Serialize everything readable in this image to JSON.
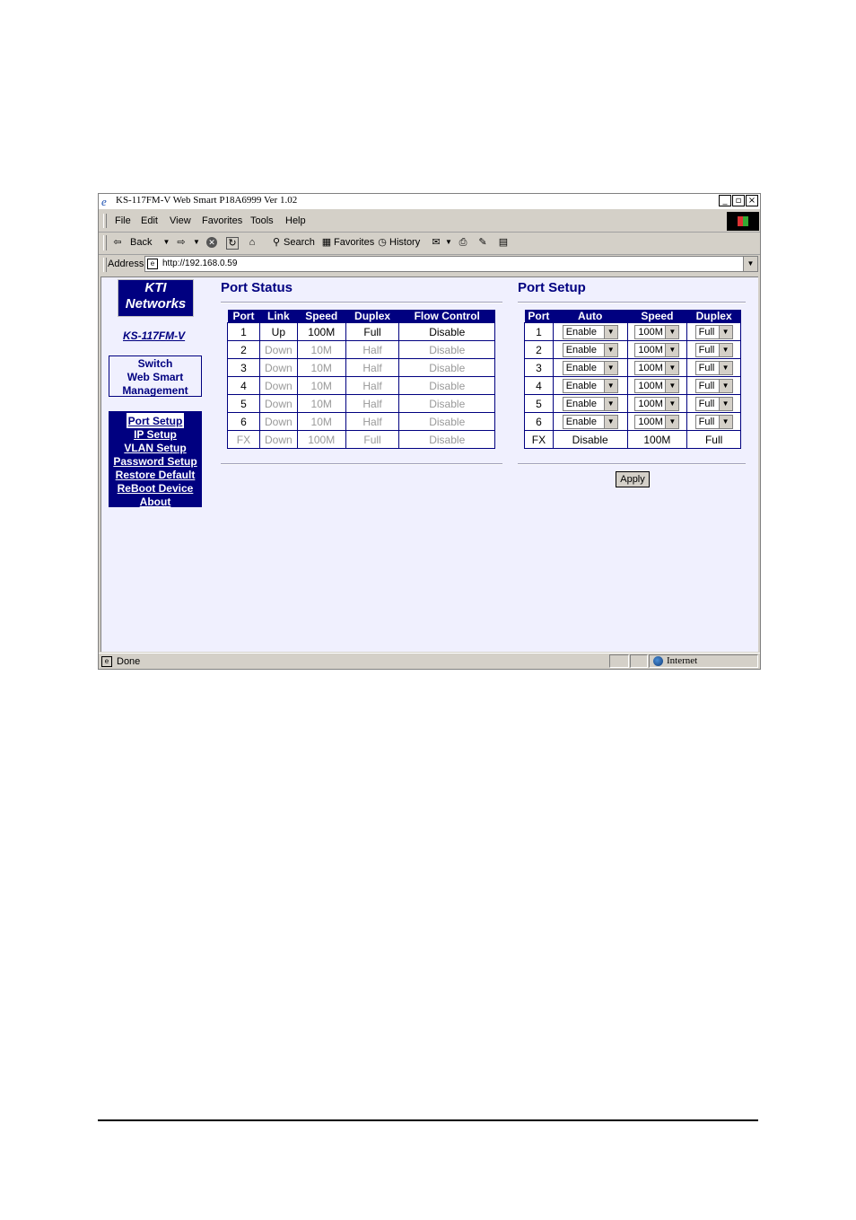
{
  "window": {
    "title": "KS-117FM-V Web Smart P18A6999 Ver 1.02",
    "buttons": [
      "_",
      "▫",
      "×"
    ]
  },
  "menu": [
    "File",
    "Edit",
    "View",
    "Favorites",
    "Tools",
    "Help"
  ],
  "toolbar": {
    "back": "Back",
    "search": "Search",
    "favorites": "Favorites",
    "history": "History"
  },
  "address": {
    "label": "Address",
    "url": "http://192.168.0.59"
  },
  "sidebar": {
    "logo_line1": "KTI",
    "logo_line2": "Networks",
    "model": "KS-117FM-V",
    "box_line1": "Switch",
    "box_line2": "Web Smart",
    "box_line3": "Management",
    "nav": [
      "Port Setup",
      "IP Setup",
      "VLAN Setup",
      "Password Setup",
      "Restore Default",
      "ReBoot Device",
      "About"
    ]
  },
  "port_status": {
    "title": "Port Status",
    "headers": [
      "Port",
      "Link",
      "Speed",
      "Duplex",
      "Flow Control"
    ],
    "rows": [
      [
        "1",
        "Up",
        "100M",
        "Full",
        "Disable"
      ],
      [
        "2",
        "Down",
        "10M",
        "Half",
        "Disable"
      ],
      [
        "3",
        "Down",
        "10M",
        "Half",
        "Disable"
      ],
      [
        "4",
        "Down",
        "10M",
        "Half",
        "Disable"
      ],
      [
        "5",
        "Down",
        "10M",
        "Half",
        "Disable"
      ],
      [
        "6",
        "Down",
        "10M",
        "Half",
        "Disable"
      ],
      [
        "FX",
        "Down",
        "100M",
        "Full",
        "Disable"
      ]
    ]
  },
  "port_setup": {
    "title": "Port Setup",
    "headers": [
      "Port",
      "Auto",
      "Speed",
      "Duplex"
    ],
    "rows": [
      [
        "1",
        "Enable",
        "100M",
        "Full"
      ],
      [
        "2",
        "Enable",
        "100M",
        "Full"
      ],
      [
        "3",
        "Enable",
        "100M",
        "Full"
      ],
      [
        "4",
        "Enable",
        "100M",
        "Full"
      ],
      [
        "5",
        "Enable",
        "100M",
        "Full"
      ],
      [
        "6",
        "Enable",
        "100M",
        "Full"
      ]
    ],
    "fx_row": [
      "FX",
      "Disable",
      "100M",
      "Full"
    ],
    "apply": "Apply"
  },
  "status": {
    "text": "Done",
    "zone": "Internet"
  },
  "colors": {
    "navy": "#000080",
    "page_bg": "#f0f0fe",
    "chrome": "#d4d0c8"
  }
}
